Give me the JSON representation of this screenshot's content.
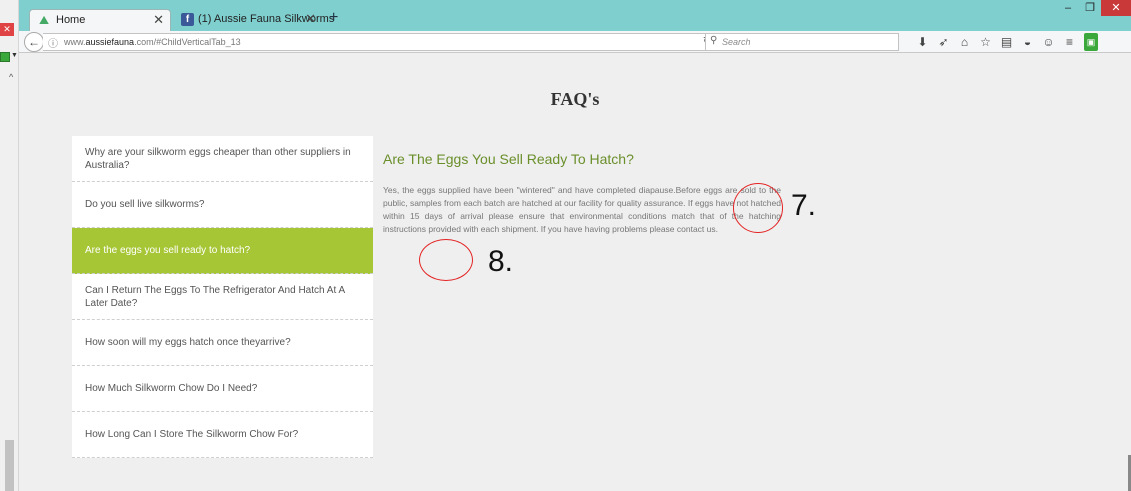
{
  "browser": {
    "tabs": [
      {
        "label": "Home",
        "favicon": "home-icon"
      },
      {
        "label": "(1) Aussie Fauna Silkworms",
        "favicon": "facebook-icon"
      }
    ],
    "url_prefix": "www.",
    "url_domain": "aussiefauna",
    "url_rest": ".com/#ChildVerticalTab_13",
    "search_placeholder": "Search"
  },
  "page": {
    "heading": "FAQ's",
    "questions": [
      {
        "label": "Why are your silkworm eggs cheaper than other suppliers in Australia?",
        "active": false
      },
      {
        "label": "Do you sell live silkworms?",
        "active": false
      },
      {
        "label": "Are the eggs you sell ready to hatch?",
        "active": true
      },
      {
        "label": "Can I Return The Eggs To The Refrigerator And Hatch At A Later Date?",
        "active": false
      },
      {
        "label": "How soon will my eggs hatch once theyarrive?",
        "active": false
      },
      {
        "label": "How Much Silkworm Chow Do I Need?",
        "active": false
      },
      {
        "label": "How Long Can I Store The Silkworm Chow For?",
        "active": false
      }
    ],
    "answer_title": "Are The Eggs You Sell Ready To Hatch?",
    "answer_body": "Yes, the eggs supplied have been \"wintered\" and have completed diapause.Before eggs are sold to the public, samples from each batch are hatched at our facility for quality assurance. If eggs have not hatched within 15 days of arrival please ensure that environmental conditions match that of the hatching instructions provided with each shipment. If you have having problems please contact us."
  },
  "annotations": [
    {
      "number": "7."
    },
    {
      "number": "8."
    }
  ],
  "colors": {
    "tabbar": "#7fcfcf",
    "active_item": "#a7c636",
    "answer_title": "#6a8f2a",
    "annotation_circle": "#e42323"
  }
}
